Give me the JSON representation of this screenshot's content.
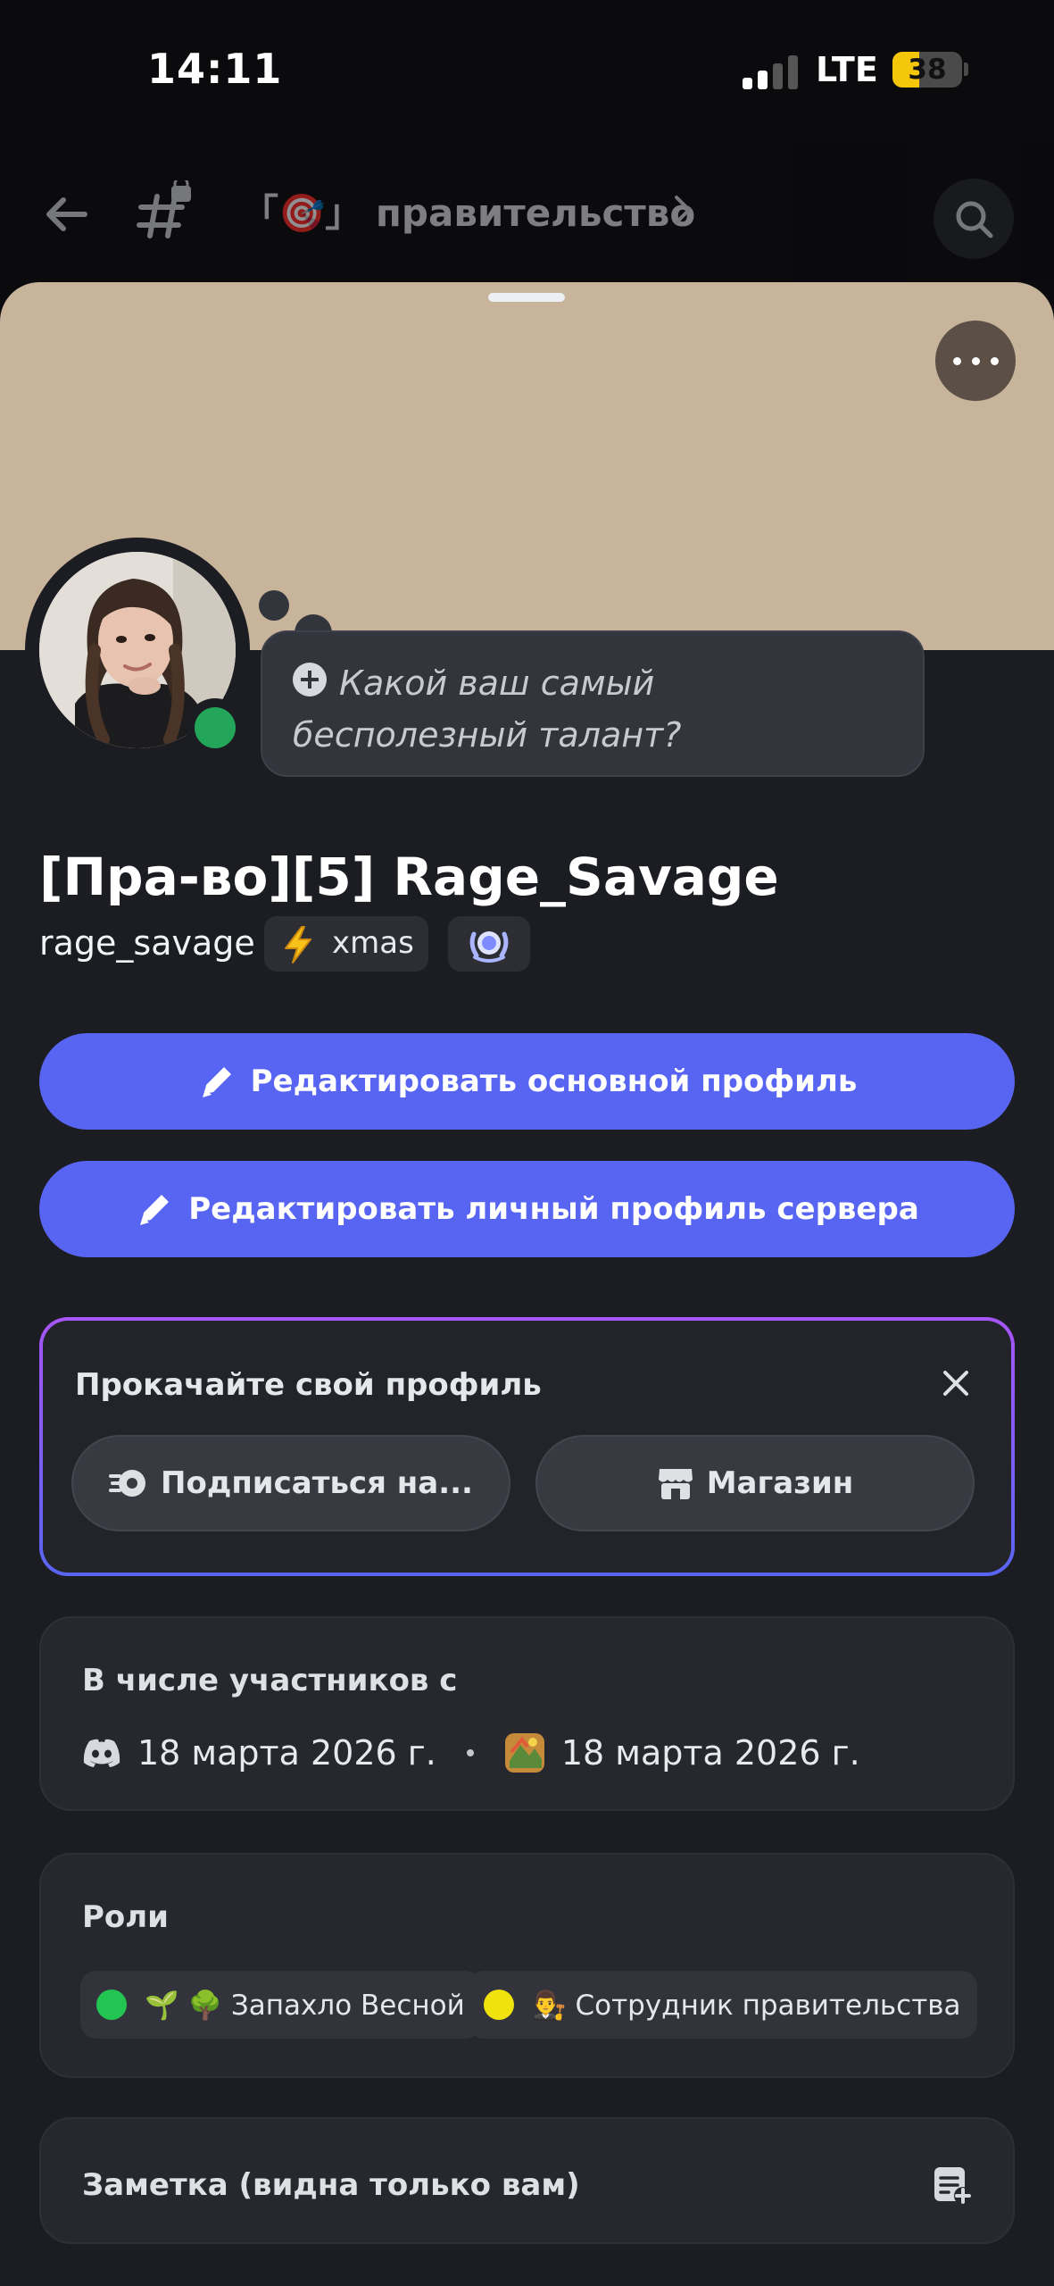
{
  "status_bar": {
    "time": "14:11",
    "network": "LTE",
    "battery": "38",
    "battery_level": 0.38,
    "battery_color": "#f5c70a"
  },
  "channel_header": {
    "name": "「🎯」 правительство",
    "icons": [
      "back-arrow-icon",
      "locked-hash-icon",
      "chevron-right-icon",
      "search-icon"
    ]
  },
  "profile": {
    "banner_color": "#c8b39b",
    "status": "online",
    "status_color": "#23a55a",
    "status_prompt": "Какой ваш самый бесполезный талант?",
    "display_name": "[Пра-во][5] Rage_Savage",
    "username": "rage_savage",
    "tag": "xmas",
    "tag_icon": "lightning-bolt-icon",
    "badge_icon": "laurel-badge-icon"
  },
  "actions": {
    "edit_main": "Редактировать основной профиль",
    "edit_server": "Редактировать личный профиль сервера",
    "accent_color": "#5865f2"
  },
  "upgrade": {
    "title": "Прокачайте свой профиль",
    "subscribe": "Подписаться на...",
    "shop": "Магазин"
  },
  "member_since": {
    "title": "В числе участников с",
    "discord_date": "18 марта 2026 г.",
    "server_date": "18 марта 2026 г."
  },
  "roles": {
    "title": "Роли",
    "items": [
      {
        "label": "🌱 🌳 Запахло Весной",
        "color": "#23c552"
      },
      {
        "label": "👨‍⚖️ Сотрудник правительства",
        "color": "#f0e20c"
      }
    ]
  },
  "note": {
    "title": "Заметка (видна только вам)"
  }
}
